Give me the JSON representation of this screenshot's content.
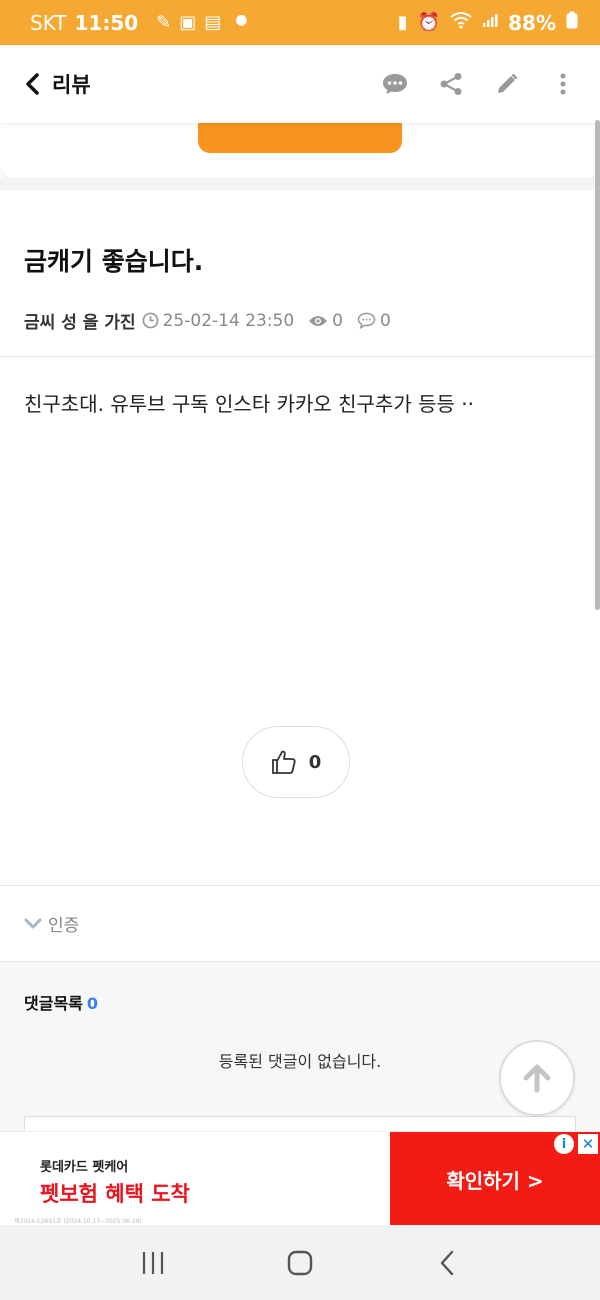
{
  "status_bar": {
    "carrier": "SKT",
    "time": "11:50",
    "battery": "88%"
  },
  "header": {
    "title": "리뷰",
    "icons": [
      "back-icon",
      "chat-icon",
      "share-icon",
      "edit-icon",
      "more-icon"
    ]
  },
  "post": {
    "title": "금캐기 좋습니다.",
    "author": "금씨 성 을 가진",
    "datetime": "25-02-14 23:50",
    "views": "0",
    "comments": "0",
    "body": "친구초대. 유투브 구독 인스타 카카오 친구추가 등등  ··",
    "likes": "0"
  },
  "tag": {
    "label": "인증"
  },
  "comments": {
    "heading": "댓글목록",
    "count": "0",
    "empty_message": "등록된 댓글이 없습니다."
  },
  "ad": {
    "small_text": "롯데카드 펫케어",
    "headline": "펫보험 혜택 도착",
    "fine_print": "제2024-E2691호 (2024.10.17~2025.06.28)",
    "cta": "확인하기 >",
    "info": "i",
    "close": "✕"
  },
  "colors": {
    "status_bar": "#f5a832",
    "accent_orange": "#f7941d",
    "comment_count": "#3d7fe8",
    "ad_red": "#f21c14"
  }
}
